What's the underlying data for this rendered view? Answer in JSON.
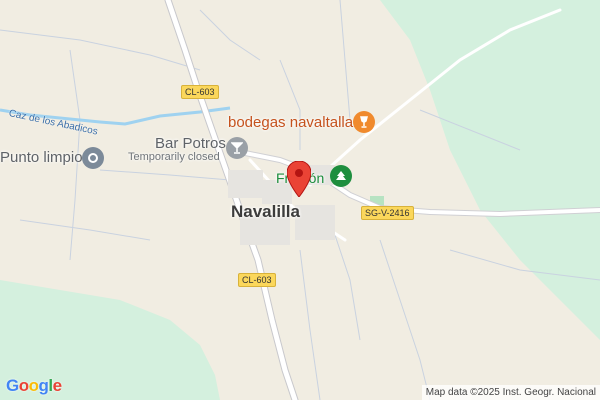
{
  "map": {
    "town": "Navalilla",
    "roads": {
      "cl603_north": "CL-603",
      "cl603_south": "CL-603",
      "sgv2416": "SG-V-2416"
    },
    "waterway": "Caz de los Abadicos",
    "pois": {
      "bar_potros": {
        "name": "Bar Potros",
        "status": "Temporarily closed",
        "icon": "cocktail-icon"
      },
      "punto_limpio": {
        "name": "Punto limpio",
        "icon": "recycle-point-icon"
      },
      "bodegas": {
        "name": "bodegas navaltallar",
        "icon": "wine-glass-icon"
      },
      "fronton": {
        "name": "Frontón",
        "icon": "tree-park-icon"
      }
    },
    "marker": {
      "icon": "location-pin-icon",
      "color": "#ea4335"
    },
    "colors": {
      "land": "#f1ede2",
      "forest": "#d4f0de",
      "road": "#ffffff",
      "water": "#9fd2f0"
    }
  },
  "branding": {
    "logo": "Google"
  },
  "attribution": "Map data ©2025 Inst. Geogr. Nacional"
}
